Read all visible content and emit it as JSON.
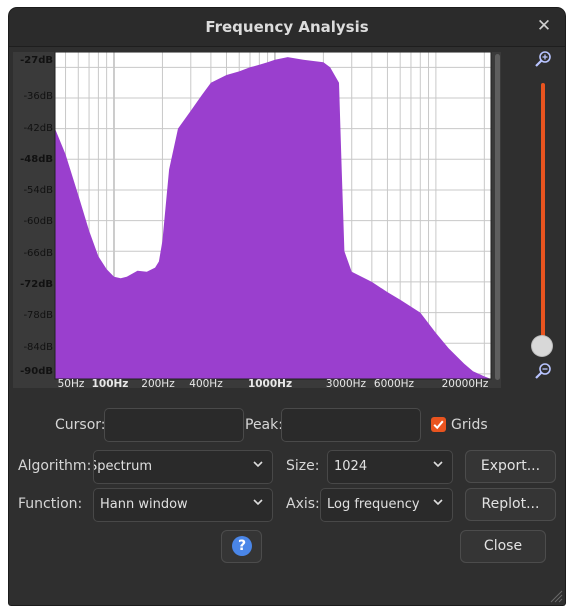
{
  "window": {
    "title": "Frequency Analysis"
  },
  "plot": {
    "db_labels": [
      "-27dB",
      "-36dB",
      "-42dB",
      "-48dB",
      "-54dB",
      "-60dB",
      "-66dB",
      "-72dB",
      "-78dB",
      "-84dB",
      "-90dB"
    ],
    "hz_labels": [
      "50Hz",
      "100Hz",
      "200Hz",
      "400Hz",
      "1000Hz",
      "3000Hz",
      "6000Hz",
      "20000Hz"
    ],
    "fill_color": "#9a3fce"
  },
  "chart_data": {
    "type": "area",
    "xlabel": "",
    "ylabel": "",
    "x_scale": "log",
    "xlim": [
      43,
      22000
    ],
    "ylim": [
      -91,
      -27
    ],
    "grid": true,
    "x": [
      43,
      50,
      60,
      70,
      80,
      90,
      100,
      110,
      120,
      140,
      160,
      180,
      190,
      200,
      220,
      250,
      300,
      350,
      400,
      500,
      600,
      700,
      800,
      900,
      1000,
      1200,
      1500,
      2000,
      2200,
      2500,
      2600,
      2700,
      3000,
      4000,
      5000,
      6000,
      8000,
      10000,
      12000,
      15000,
      17000,
      20000,
      22000
    ],
    "values": [
      -42,
      -47,
      -55,
      -62,
      -67,
      -69.5,
      -71,
      -71.3,
      -71,
      -69.8,
      -70,
      -69.2,
      -68,
      -64,
      -50,
      -42,
      -38.5,
      -35.5,
      -33,
      -31.5,
      -30.8,
      -30,
      -29.5,
      -29,
      -28.5,
      -28,
      -28.5,
      -29,
      -30,
      -33,
      -50,
      -66,
      -70,
      -72,
      -74,
      -75.5,
      -78,
      -82,
      -85,
      -88,
      -89.5,
      -90.5,
      -91
    ]
  },
  "controls": {
    "cursor_label": "Cursor:",
    "cursor_value": "",
    "peak_label": "Peak:",
    "peak_value": "",
    "grids_label": "Grids",
    "grids_checked": true,
    "algorithm_label": "Algorithm:",
    "algorithm_value": "Spectrum",
    "size_label": "Size:",
    "size_value": "1024",
    "function_label": "Function:",
    "function_value": "Hann window",
    "axis_label": "Axis:",
    "axis_value": "Log frequency"
  },
  "buttons": {
    "export": "Export...",
    "replot": "Replot...",
    "close": "Close",
    "help": "?"
  },
  "icons": {
    "zoom_in": "magnifier-plus-icon",
    "zoom_out": "magnifier-minus-icon",
    "close": "close-icon",
    "help": "help-icon",
    "chevron": "chevron-down-icon",
    "check": "checkmark-icon",
    "resize": "resize-grip-icon"
  },
  "colors": {
    "accent": "#e9541f",
    "help": "#4a86e8",
    "spectrum": "#9a3fce"
  }
}
